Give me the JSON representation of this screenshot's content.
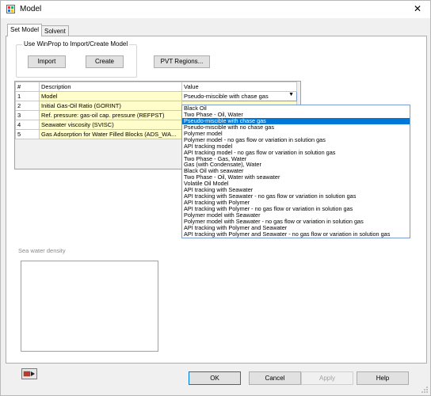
{
  "window": {
    "title": "Model",
    "close_icon": "close-x"
  },
  "tabs": [
    {
      "label": "Set Model"
    },
    {
      "label": "Solvent"
    }
  ],
  "group": {
    "label": "Use WinProp to Import/Create Model",
    "import_label": "Import",
    "create_label": "Create"
  },
  "pvt_button_label": "PVT Regions...",
  "grid": {
    "headers": [
      "#",
      "Description",
      "Value"
    ],
    "rows": [
      {
        "num": "1",
        "description": "Model",
        "value": "Pseudo-miscible with chase gas"
      },
      {
        "num": "2",
        "description": "Initial Gas-Oil Ratio (GORINT)",
        "value": ""
      },
      {
        "num": "3",
        "description": "Ref. pressure: gas-oil cap. pressure (REFPST)",
        "value": ""
      },
      {
        "num": "4",
        "description": "Seawater viscosity (SVISC)",
        "value": ""
      },
      {
        "num": "5",
        "description": "Gas Adsorption for Water Filled Blocks (ADS_WA...",
        "value": ""
      }
    ]
  },
  "dropdown_options": [
    "Black Oil",
    "Two Phase - Oil, Water",
    "Pseudo-miscible with chase gas",
    "Pseudo-miscible with no chase gas",
    "Polymer model",
    "Polymer model - no gas flow or variation in solution gas",
    "API tracking model",
    "API tracking model - no gas flow or variation in solution gas",
    "Two Phase - Gas, Water",
    "Gas (with Condensate), Water",
    "Black Oil with seawater",
    "Two Phase - Oil, Water with seawater",
    "Volatile Oil Model",
    "API tracking with Seawater",
    "API tracking with Seawater - no gas flow or variation in solution gas",
    "API tracking with Polymer",
    "API tracking with Polymer - no gas flow or variation in solution gas",
    "Polymer model with Seawater",
    "Polymer model with Seawater - no gas flow or variation in solution gas",
    "API tracking with Polymer and Seawater",
    "API tracking with Polymer and Seawater - no gas flow or variation in solution gas"
  ],
  "selected_index": 2,
  "seawater_label": "Sea water density",
  "buttons": {
    "ok": "OK",
    "cancel": "Cancel",
    "apply": "Apply",
    "help": "Help"
  },
  "colors": {
    "selection": "#0078d7",
    "editable_cell": "#fffdc9"
  }
}
